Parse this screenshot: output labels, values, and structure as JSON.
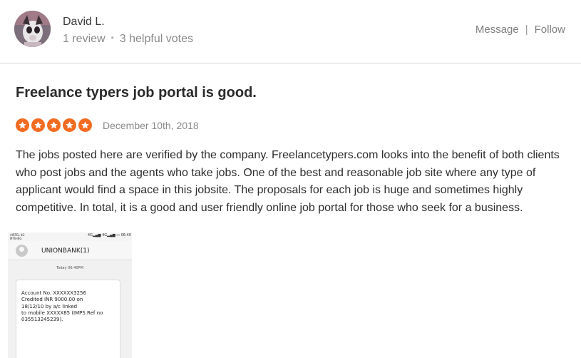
{
  "reviewer": {
    "name": "David L.",
    "review_count": "1 review",
    "helpful_votes": "3 helpful votes",
    "separator_dot": "•",
    "avatar_icon": "user-avatar-photo"
  },
  "actions": {
    "message_label": "Message",
    "separator": "|",
    "follow_label": "Follow"
  },
  "review": {
    "title": "Freelance typers job portal is good.",
    "rating": 5,
    "rating_max": 5,
    "date": "December 10th, 2018",
    "body": "The jobs posted here are verified by the company. Freelancetypers.com looks into the benefit of both clients who post jobs and the agents who take jobs. One of the best and reasonable job site where any type of applicant would find a space in this jobsite. The proposals for each job is huge and sometimes highly competitive. In total, it is a good and user friendly online job portal for those who seek for a business."
  },
  "attachment": {
    "carrier": "AIRTEL 4G\nMTN-NG",
    "status_time": "4G▂▄▆ 4G▂▄▆ ▭ 06:40",
    "contact_name": "UNIONBANK(1)",
    "message_time": "Today 06:40PM",
    "message_text": "Account No. XXXXXX3256\nCredited INR 9000.00 on\n18/12/10 by a/c linked\nto mobile XXXXX85 (IMPS Ref no\n035513245239)."
  },
  "colors": {
    "star": "#f26b21",
    "divider": "#d9d9d9",
    "muted_text": "#8a8a8a"
  }
}
